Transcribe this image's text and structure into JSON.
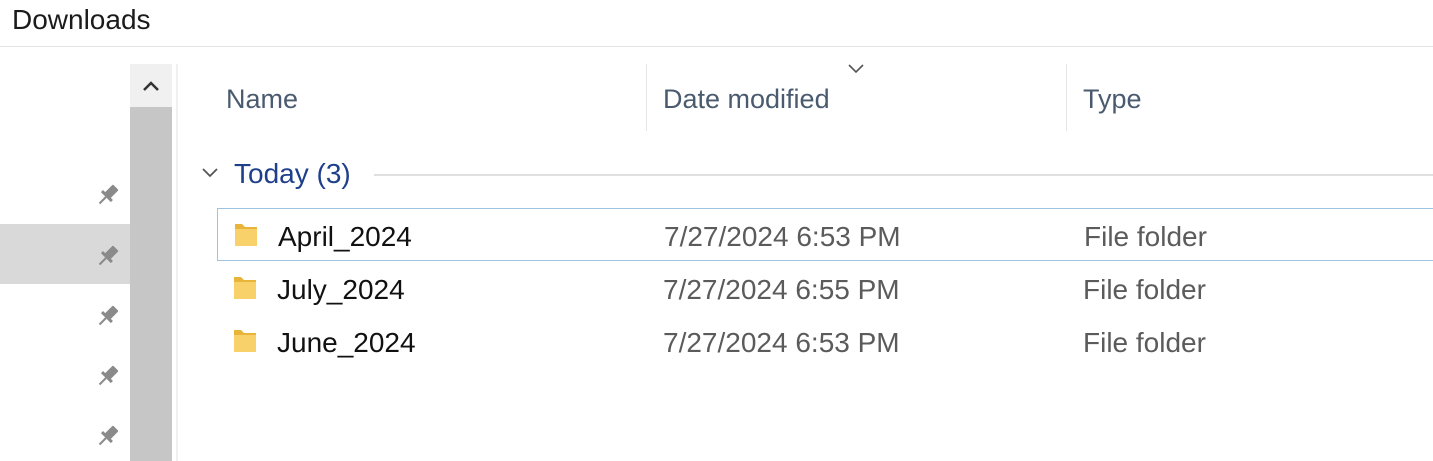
{
  "window": {
    "title": "Downloads"
  },
  "columns": {
    "name": "Name",
    "date_modified": "Date modified",
    "type": "Type",
    "sort_column": "date_modified",
    "sort_direction": "descending"
  },
  "group": {
    "label": "Today (3)",
    "expanded": true
  },
  "rows": [
    {
      "name": "April_2024",
      "date": "7/27/2024 6:53 PM",
      "type": "File folder",
      "icon": "folder-icon",
      "focused": true
    },
    {
      "name": "July_2024",
      "date": "7/27/2024 6:55 PM",
      "type": "File folder",
      "icon": "folder-icon",
      "focused": false
    },
    {
      "name": "June_2024",
      "date": "7/27/2024 6:53 PM",
      "type": "File folder",
      "icon": "folder-icon",
      "focused": false
    }
  ],
  "nav": {
    "items": [
      {
        "icon": "pin-icon",
        "selected": false
      },
      {
        "icon": "pin-icon",
        "selected": true
      },
      {
        "icon": "pin-icon",
        "selected": false
      },
      {
        "icon": "pin-icon",
        "selected": false
      },
      {
        "icon": "pin-icon",
        "selected": false
      }
    ]
  },
  "colors": {
    "group_label": "#1e3f8a",
    "folder": "#f5c84c",
    "selection_bg": "#d9d9d9",
    "focus_border": "#9ec3e0",
    "scrollbar": "#c6c6c6"
  }
}
